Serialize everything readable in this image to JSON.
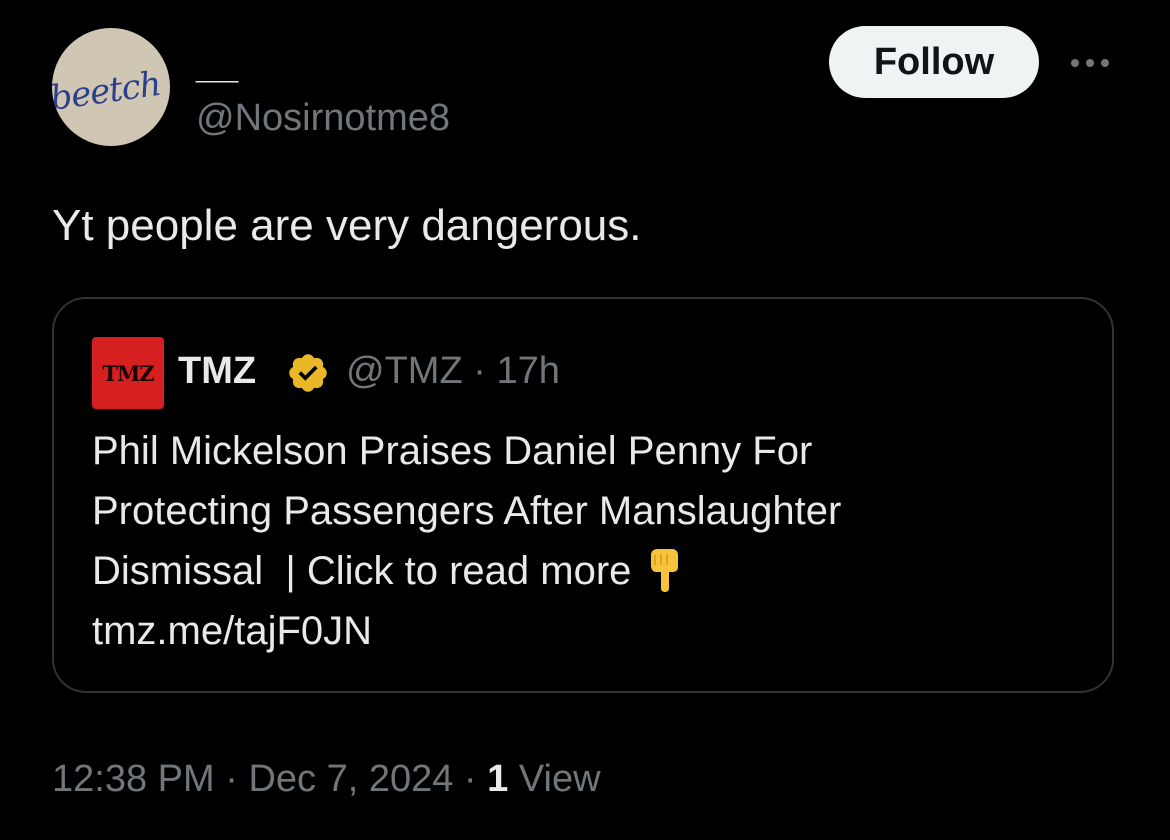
{
  "author": {
    "avatar_text": "beetch",
    "display_name": "__",
    "handle": "@Nosirnotme8"
  },
  "actions": {
    "follow_label": "Follow",
    "more_icon": "more-horizontal-icon"
  },
  "tweet": {
    "text": "Yt people are very dangerous."
  },
  "quote": {
    "logo_text": "TMZ",
    "name": "TMZ",
    "verified_icon": "verified-badge-icon",
    "handle": "@TMZ",
    "separator": "·",
    "time": "17h",
    "lines": [
      "Phil Mickelson Praises Daniel Penny For",
      "Protecting Passengers After Manslaughter",
      "Dismissal  | Click to read more",
      "tmz.me/tajF0JN"
    ],
    "line3_icon": "pointing-down-hand-icon"
  },
  "footer": {
    "time": "12:38 PM",
    "separator": "·",
    "date": "Dec 7, 2024",
    "views_count": "1",
    "views_label": "View"
  },
  "colors": {
    "background": "#000000",
    "text_primary": "#e7e9ea",
    "text_secondary": "#71767b",
    "border": "#2f3336",
    "follow_bg": "#eff3f4",
    "verified_gold": "#e8b829",
    "tmz_red": "#d61f1f"
  }
}
